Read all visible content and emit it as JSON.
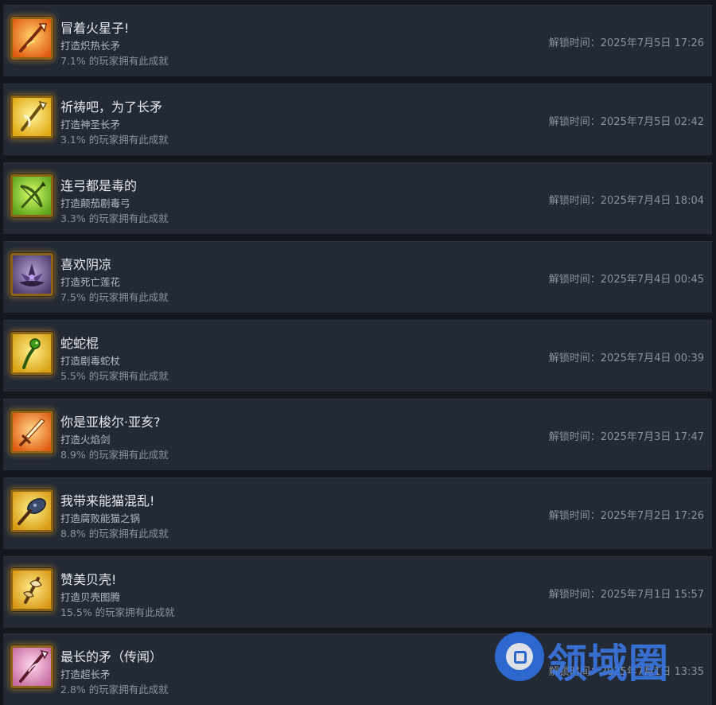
{
  "achievements": [
    {
      "name": "冒着火星子!",
      "desc": "打造炽热长矛",
      "rate": "7.1% 的玩家拥有此成就",
      "time": "解锁时间：2025年7月5日 17:26",
      "icon": "fire-spear-icon",
      "bg": "#e8671a"
    },
    {
      "name": "祈祷吧，为了长矛",
      "desc": "打造神圣长矛",
      "rate": "3.1% 的玩家拥有此成就",
      "time": "解锁时间：2025年7月5日 02:42",
      "icon": "holy-spear-icon",
      "bg": "#e8c21a"
    },
    {
      "name": "连弓都是毒的",
      "desc": "打造颠茄剧毒弓",
      "rate": "3.3% 的玩家拥有此成就",
      "time": "解锁时间：2025年7月4日 18:04",
      "icon": "poison-bow-icon",
      "bg": "#8fcf2a"
    },
    {
      "name": "喜欢阴凉",
      "desc": "打造死亡莲花",
      "rate": "7.5% 的玩家拥有此成就",
      "time": "解锁时间：2025年7月4日 00:45",
      "icon": "death-lotus-icon",
      "bg": "#9a7fc0"
    },
    {
      "name": "蛇蛇棍",
      "desc": "打造剧毒蛇杖",
      "rate": "5.5% 的玩家拥有此成就",
      "time": "解锁时间：2025年7月4日 00:39",
      "icon": "snake-staff-icon",
      "bg": "#e6c21c"
    },
    {
      "name": "你是亚梭尔·亚亥?",
      "desc": "打造火焰剑",
      "rate": "8.9% 的玩家拥有此成就",
      "time": "解锁时间：2025年7月3日 17:47",
      "icon": "flame-sword-icon",
      "bg": "#ec7a22"
    },
    {
      "name": "我带来能猫混乱!",
      "desc": "打造腐败能猫之锅",
      "rate": "8.8% 的玩家拥有此成就",
      "time": "解锁时间：2025年7月2日 17:26",
      "icon": "panda-wok-icon",
      "bg": "#e8b81a"
    },
    {
      "name": "赞美贝壳!",
      "desc": "打造贝壳图腾",
      "rate": "15.5% 的玩家拥有此成就",
      "time": "解锁时间：2025年7月1日 15:57",
      "icon": "shell-totem-icon",
      "bg": "#e9b21a"
    },
    {
      "name": "最长的矛（传闻）",
      "desc": "打造超长矛",
      "rate": "2.8% 的玩家拥有此成就",
      "time": "解锁时间：2025年7月1日 13:35",
      "icon": "long-spear-icon",
      "bg": "#e59ac6"
    }
  ],
  "watermark": {
    "text": "领域圈"
  }
}
